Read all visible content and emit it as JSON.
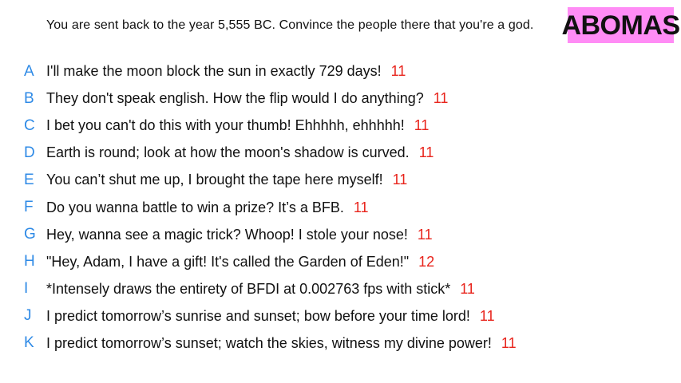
{
  "prompt": "You are sent back to the year 5,555 BC. Convince the people there that you're a god.",
  "team": {
    "name": "ABOMAS",
    "badge_color": "#ff8cf5"
  },
  "colors": {
    "letter": "#2e8ae6",
    "score": "#e8241c",
    "text": "#111111"
  },
  "entries": [
    {
      "letter": "A",
      "text": "I'll make the moon block the sun in exactly 729 days!",
      "score": "11"
    },
    {
      "letter": "B",
      "text": "They don't speak english. How the flip would I do anything?",
      "score": "11"
    },
    {
      "letter": "C",
      "text": "I bet you can't do this with your thumb! Ehhhhh, ehhhhh!",
      "score": "11"
    },
    {
      "letter": "D",
      "text": "Earth is round; look at how the moon's shadow is curved.",
      "score": "11"
    },
    {
      "letter": "E",
      "text": "You can’t shut me up, I brought the tape here myself!",
      "score": "11"
    },
    {
      "letter": "F",
      "text": "Do you wanna battle to win a prize? It’s a BFB.",
      "score": "11"
    },
    {
      "letter": "G",
      "text": "Hey, wanna see a magic trick? Whoop! I stole your nose!",
      "score": "11"
    },
    {
      "letter": "H",
      "text": "\"Hey, Adam, I have a gift! It's called the Garden of Eden!\"",
      "score": "12"
    },
    {
      "letter": "I",
      "text": "*Intensely draws the entirety of BFDI at 0.002763 fps with stick*",
      "score": "11"
    },
    {
      "letter": "J",
      "text": "I predict tomorrow’s sunrise and sunset; bow before your time lord!",
      "score": "11"
    },
    {
      "letter": "K",
      "text": "I predict tomorrow’s sunset; watch the skies, witness my divine power!",
      "score": "11"
    }
  ]
}
